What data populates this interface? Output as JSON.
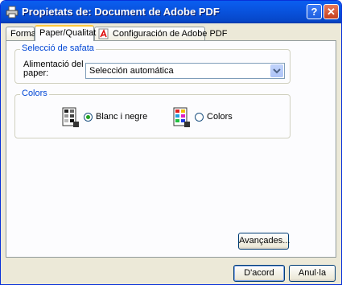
{
  "window": {
    "title": "Propietats de: Document de Adobe PDF",
    "help_button": "?",
    "close_button": "✕"
  },
  "tabs": [
    {
      "label": "Format",
      "active": false
    },
    {
      "label": "Paper/Qualitat",
      "active": true
    },
    {
      "label": "Configuración de Adobe PDF",
      "active": false
    }
  ],
  "paper_source_group": {
    "title": "Selecció de safata",
    "label": "Alimentació del paper:",
    "selected_value": "Selección automática"
  },
  "colors_group": {
    "title": "Colors",
    "options": [
      {
        "label": "Blanc i negre",
        "checked": true,
        "icon": "black-white-page-icon"
      },
      {
        "label": "Colors",
        "checked": false,
        "icon": "color-page-icon"
      }
    ]
  },
  "buttons": {
    "advanced": "Avançades...",
    "ok": "D'acord",
    "cancel": "Anul·la"
  },
  "colors": {
    "titlebar": "#0a5ef0",
    "group_title": "#0046d5",
    "dialog_bg": "#ece9d8"
  }
}
